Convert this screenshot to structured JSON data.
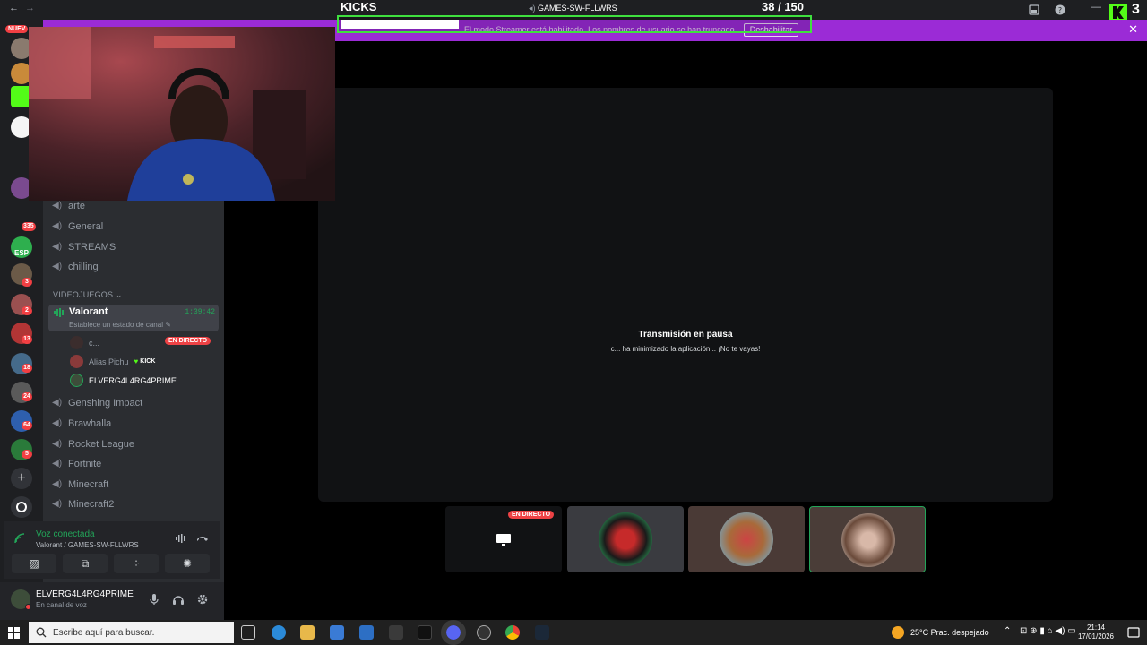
{
  "kicks": {
    "title": "KICKS",
    "channel": "GAMES-SW-FLLWRS",
    "count": "38",
    "total": "/ 150",
    "progress_fraction": 0.253
  },
  "banner": {
    "text": "El modo Streamer está habilitado. Los nombres de usuario se han truncado.",
    "button": "Deshabilitar"
  },
  "rail": {
    "new_label": "NUEV",
    "esp_label": "ESP",
    "badges": [
      "335",
      "3",
      "2",
      "13",
      "18",
      "24",
      "64",
      "5"
    ]
  },
  "sidebar": {
    "channels_top": [
      "arte",
      "General",
      "STREAMS",
      "chilling"
    ],
    "category": "VIDEOJUEGOS",
    "active_channel": {
      "name": "Valorant",
      "time": "1:39:42",
      "status": "Establece un estado de canal"
    },
    "voice_users": [
      {
        "name": "c...",
        "live_label": "EN DIRECTO"
      },
      {
        "name": "Alias Pichu",
        "tag": "KICK"
      },
      {
        "name": "ELVERG4L4RG4PRIME"
      }
    ],
    "channels_bottom": [
      "Genshing Impact",
      "Brawhalla",
      "Rocket League",
      "Fortnite",
      "Minecraft",
      "Minecraft2"
    ]
  },
  "voice_panel": {
    "status": "Voz conectada",
    "location": "Valorant / GAMES-SW-FLLWRS"
  },
  "user_panel": {
    "username": "ELVERG4L4RG4PRIME",
    "status": "En canal de voz"
  },
  "stage": {
    "pause_title": "Transmisión en pausa",
    "pause_sub": "c... ha minimizado la aplicación... ¡No te vayas!",
    "tile_live_label": "EN DIRECTO"
  },
  "taskbar": {
    "search_placeholder": "Escribe aquí para buscar.",
    "weather": "25°C  Prac. despejado",
    "time": "21:14",
    "date": "17/01/2026"
  },
  "overlay_top_right": "3",
  "colors": {
    "banner": "#9b2bd6",
    "kick_green": "#3fe03f",
    "live_red": "#ed4245",
    "voice_green": "#23a559"
  }
}
